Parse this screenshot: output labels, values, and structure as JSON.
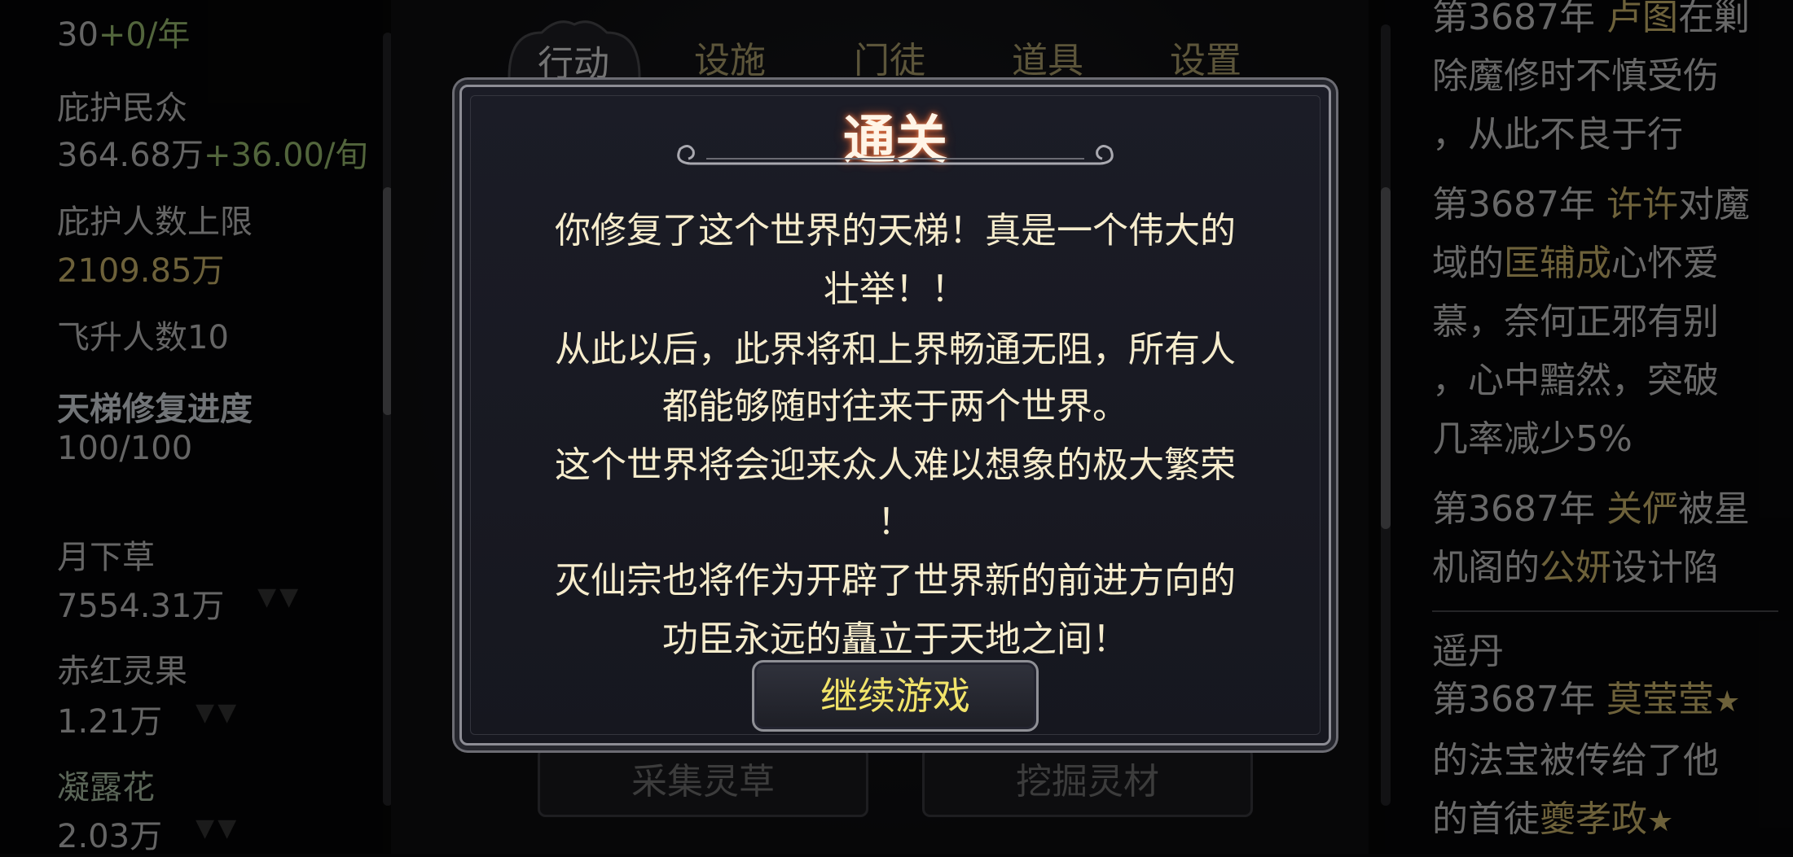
{
  "left_panel": {
    "stats": [
      {
        "label": "",
        "value": "30",
        "delta": "+0/年"
      },
      {
        "label": "庇护民众",
        "value": "364.68万",
        "delta": "+36.00/旬"
      },
      {
        "label": "庇护人数上限",
        "value": "2109.85万",
        "delta": ""
      },
      {
        "label": "飞升人数10",
        "value": "",
        "delta": ""
      },
      {
        "label": "天梯修复进度",
        "value": "100/100",
        "delta": ""
      }
    ],
    "resources": [
      {
        "name": "月下草",
        "amount": "7554.31万"
      },
      {
        "name": "赤红灵果",
        "amount": "1.21万"
      },
      {
        "name": "凝露花",
        "amount": "2.03万"
      }
    ],
    "arrows": "▼▼"
  },
  "tabs": [
    "行动",
    "设施",
    "门徒",
    "道具",
    "设置"
  ],
  "active_tab_index": 0,
  "background_buttons": [
    "采集灵草",
    "挖掘灵材"
  ],
  "modal": {
    "title": "通关",
    "lines": [
      "你修复了这个世界的天梯！真是一个伟大的",
      "壮举！！",
      "从此以后，此界将和上界畅通无阻，所有人",
      "都能够随时往来于两个世界。",
      "这个世界将会迎来众人难以想象的极大繁荣",
      "！",
      "灭仙宗也将作为开辟了世界新的前进方向的",
      "功臣永远的矗立于天地之间！"
    ],
    "button": "继续游戏"
  },
  "log_panel": {
    "entries": [
      {
        "segments": [
          {
            "t": "第3687年 "
          },
          {
            "t": "卢图",
            "n": true
          },
          {
            "t": "在剿"
          }
        ],
        "lines2": [
          "除魔修时不慎受伤",
          "，从此不良于行"
        ]
      },
      {
        "segments": [
          {
            "t": "第3687年 "
          },
          {
            "t": "许许",
            "n": true
          },
          {
            "t": "对魔"
          }
        ],
        "line2": [
          {
            "t": "域的"
          },
          {
            "t": "匡辅成",
            "n": true
          },
          {
            "t": "心怀爱"
          }
        ],
        "lines3": [
          "慕，奈何正邪有别",
          "，心中黯然，突破",
          "几率减少5%"
        ]
      },
      {
        "segments": [
          {
            "t": "第3687年 "
          },
          {
            "t": "关俨",
            "n": true
          },
          {
            "t": "被星"
          }
        ],
        "line2": [
          {
            "t": "机阁的"
          },
          {
            "t": "公妍",
            "n": true
          },
          {
            "t": "设计陷"
          }
        ]
      }
    ],
    "section": "遥丹",
    "section_entry": {
      "line1_prefix": "第3687年 ",
      "line1_name": "莫莹莹",
      "line2": "的法宝被传给了他",
      "line3_prefix": "的首徒",
      "line3_name": "夔孝政",
      "star": "★"
    }
  }
}
